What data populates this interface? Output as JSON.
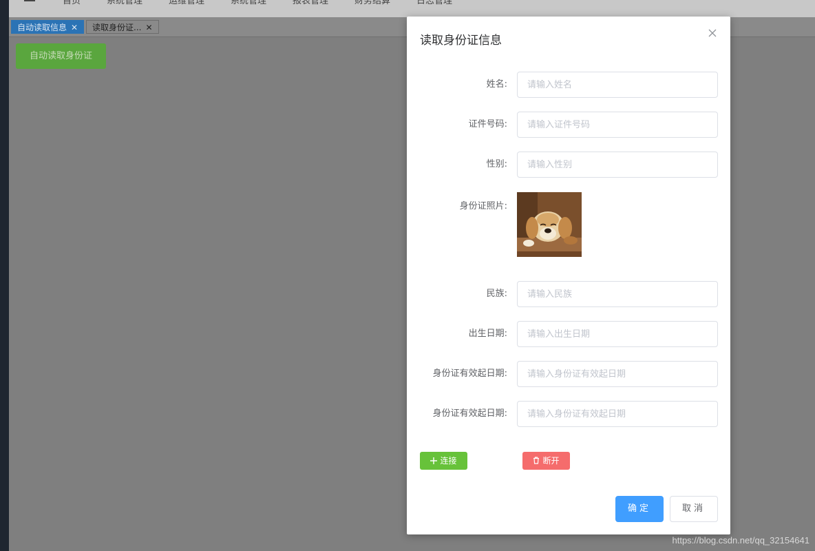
{
  "nav": {
    "items": [
      "首页",
      "系统管理",
      "运维管理",
      "系统管理",
      "报表管理",
      "财务结算",
      "日志管理"
    ]
  },
  "tags": {
    "active": "自动读取信息",
    "second": "读取身份证...",
    "close_glyph": "✕"
  },
  "main": {
    "auto_read_label": "自动读取身份证"
  },
  "dialog": {
    "title": "读取身份证信息",
    "fields": [
      {
        "label": "姓名:",
        "placeholder": "请输入姓名"
      },
      {
        "label": "证件号码:",
        "placeholder": "请输入证件号码"
      },
      {
        "label": "性别:",
        "placeholder": "请输入性别"
      },
      {
        "label": "民族:",
        "placeholder": "请输入民族"
      },
      {
        "label": "出生日期:",
        "placeholder": "请输入出生日期"
      },
      {
        "label": "身份证有效起日期:",
        "placeholder": "请输入身份证有效起日期"
      },
      {
        "label": "身份证有效起日期:",
        "placeholder": "请输入身份证有效起日期"
      }
    ],
    "photo_label": "身份证照片:",
    "connect_label": "连接",
    "disconnect_label": "断开",
    "ok_label": "确定",
    "cancel_label": "取消"
  },
  "watermark": "https://blog.csdn.net/qq_32154641",
  "colors": {
    "primary": "#409eff",
    "success": "#67c23a",
    "danger": "#f56c6c"
  }
}
